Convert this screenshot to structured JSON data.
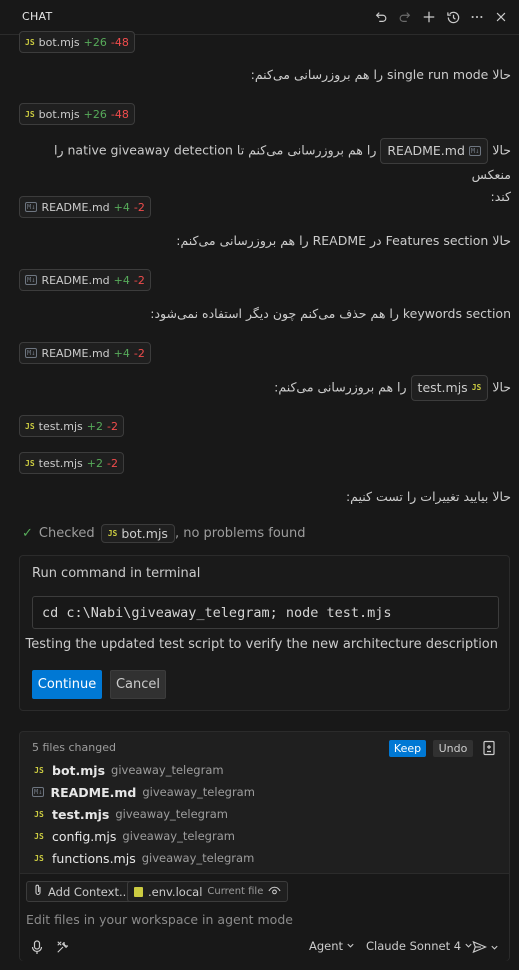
{
  "header": {
    "tab_label": "CHAT",
    "actions": [
      "undo-icon",
      "redo-icon",
      "plus-icon",
      "history-icon",
      "more-icon",
      "close-icon"
    ]
  },
  "edits": [
    {
      "file": "bot.mjs",
      "added": "+26",
      "removed": "-48",
      "kind": "js"
    },
    {
      "file": "bot.mjs",
      "added": "+26",
      "removed": "-48",
      "kind": "js"
    },
    {
      "file": "README.md",
      "added": "+4",
      "removed": "-2",
      "kind": "md"
    },
    {
      "file": "README.md",
      "added": "+4",
      "removed": "-2",
      "kind": "md"
    },
    {
      "file": "README.md",
      "added": "+4",
      "removed": "-2",
      "kind": "md"
    },
    {
      "file": "test.mjs",
      "added": "+2",
      "removed": "-2",
      "kind": "js"
    },
    {
      "file": "test.mjs",
      "added": "+2",
      "removed": "-2",
      "kind": "js"
    }
  ],
  "messages": {
    "m1": "حالا single run mode را هم بروزرسانی می‌کنم:",
    "m2_before": "حالا",
    "m2_chip": "README.md",
    "m2_line1_after": "را هم بروزرسانی می‌کنم تا native giveaway detection را منعکس",
    "m2_line2": "کند:",
    "m3": "حالا Features section در README را هم بروزرسانی می‌کنم:",
    "m4": "keywords section را هم حذف می‌کنم چون دیگر استفاده نمی‌شود:",
    "m5_before": "حالا",
    "m5_chip": "test.mjs",
    "m5_after": "را هم بروزرسانی می‌کنم:",
    "m6": "حالا بیایید تغییرات را تست کنیم:"
  },
  "checked": {
    "prefix": "Checked",
    "file": "bot.mjs",
    "suffix": ", no problems found"
  },
  "terminal": {
    "title": "Run command in terminal",
    "command": "cd c:\\Nabi\\giveaway_telegram; node test.mjs",
    "note": "Testing the updated test script to verify the new architecture description",
    "continue_label": "Continue",
    "cancel_label": "Cancel"
  },
  "changes": {
    "count_label": "5 files changed",
    "keep_label": "Keep",
    "undo_label": "Undo",
    "files": [
      {
        "name": "bot.mjs",
        "path": "giveaway_telegram",
        "kind": "js",
        "bold": true
      },
      {
        "name": "README.md",
        "path": "giveaway_telegram",
        "kind": "md",
        "bold": true
      },
      {
        "name": "test.mjs",
        "path": "giveaway_telegram",
        "kind": "js",
        "bold": true
      },
      {
        "name": "config.mjs",
        "path": "giveaway_telegram",
        "kind": "js",
        "bold": false
      },
      {
        "name": "functions.mjs",
        "path": "giveaway_telegram",
        "kind": "js",
        "bold": false
      }
    ]
  },
  "input": {
    "add_context_label": "Add Context...",
    "current_file_name": ".env.local",
    "current_file_label": "Current file",
    "placeholder": "Edit files in your workspace in agent mode",
    "mode_label": "Agent",
    "model_label": "Claude Sonnet 4"
  },
  "colors": {
    "accent": "#0078d4",
    "added": "#57ab5a",
    "removed": "#f14c4c",
    "js_badge": "#cbcb41"
  }
}
